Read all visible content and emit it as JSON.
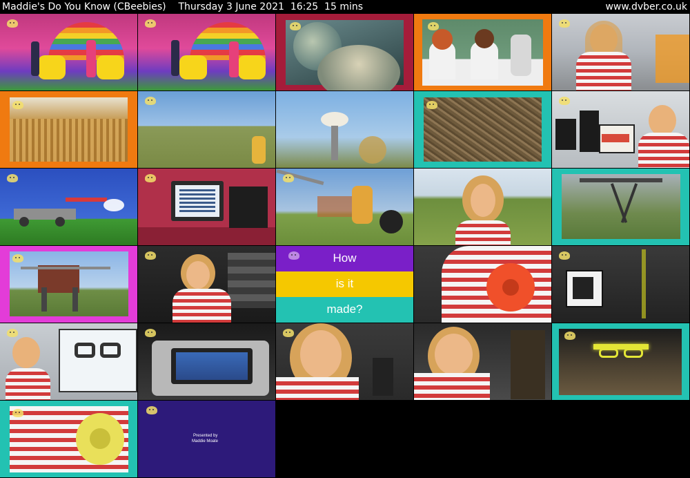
{
  "header": {
    "title": "Maddie's Do You Know (CBeebies)    Thursday 3 June 2021  16:25  15 mins",
    "site": "www.dvber.co.uk"
  },
  "how_card": {
    "line1": "How",
    "line2": "is it",
    "line3": "made?"
  },
  "credits": {
    "line1": "Presented by",
    "line2": "Maddie Moate"
  },
  "colors": {
    "purple": "#7a1fc8",
    "yellow": "#f5c800",
    "teal": "#23c2b2",
    "orange": "#f07a10",
    "crimson": "#a51c3a",
    "magenta": "#e33cd8",
    "navy": "#2d1a7a"
  }
}
